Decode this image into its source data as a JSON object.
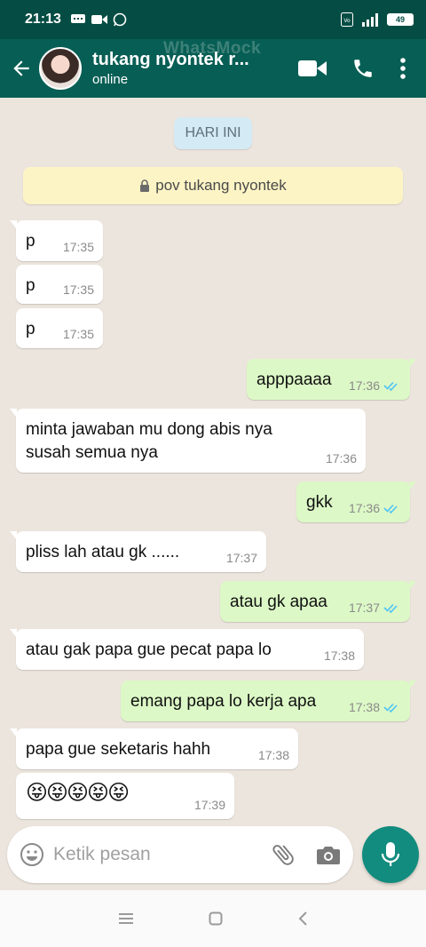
{
  "status_bar": {
    "time": "21:13",
    "battery": "49"
  },
  "header": {
    "contact_name": "tukang nyontek r...",
    "status": "online",
    "watermark": "WhatsMock"
  },
  "chat": {
    "date_chip": "HARI INI",
    "notice": "pov tukang nyontek",
    "messages": [
      {
        "dir": "in",
        "text": "p",
        "time": "17:35"
      },
      {
        "dir": "in",
        "text": "p",
        "time": "17:35"
      },
      {
        "dir": "in",
        "text": "p",
        "time": "17:35"
      },
      {
        "dir": "out",
        "text": "apppaaaa",
        "time": "17:36"
      },
      {
        "dir": "in",
        "text": "minta jawaban mu dong abis nya",
        "text2": "susah semua nya",
        "time": "17:36"
      },
      {
        "dir": "out",
        "text": "gkk",
        "time": "17:36"
      },
      {
        "dir": "in",
        "text": "pliss lah atau gk ......",
        "time": "17:37"
      },
      {
        "dir": "out",
        "text": "atau gk apaa",
        "time": "17:37"
      },
      {
        "dir": "in",
        "text": "atau gak papa gue pecat papa lo",
        "time": "17:38"
      },
      {
        "dir": "out",
        "text": "emang papa lo kerja apa",
        "time": "17:38"
      },
      {
        "dir": "in",
        "text": "papa gue seketaris hahh",
        "time": "17:38"
      },
      {
        "dir": "in",
        "text": "😝😝😝😝😝",
        "time": "17:39"
      }
    ]
  },
  "composer": {
    "placeholder": "Ketik pesan"
  },
  "colors": {
    "header": "#075e54",
    "status_bar": "#054d44",
    "outgoing": "#dcf8c6",
    "incoming": "#ffffff",
    "tick_blue": "#4fc3f7",
    "fab": "#128c7e"
  }
}
